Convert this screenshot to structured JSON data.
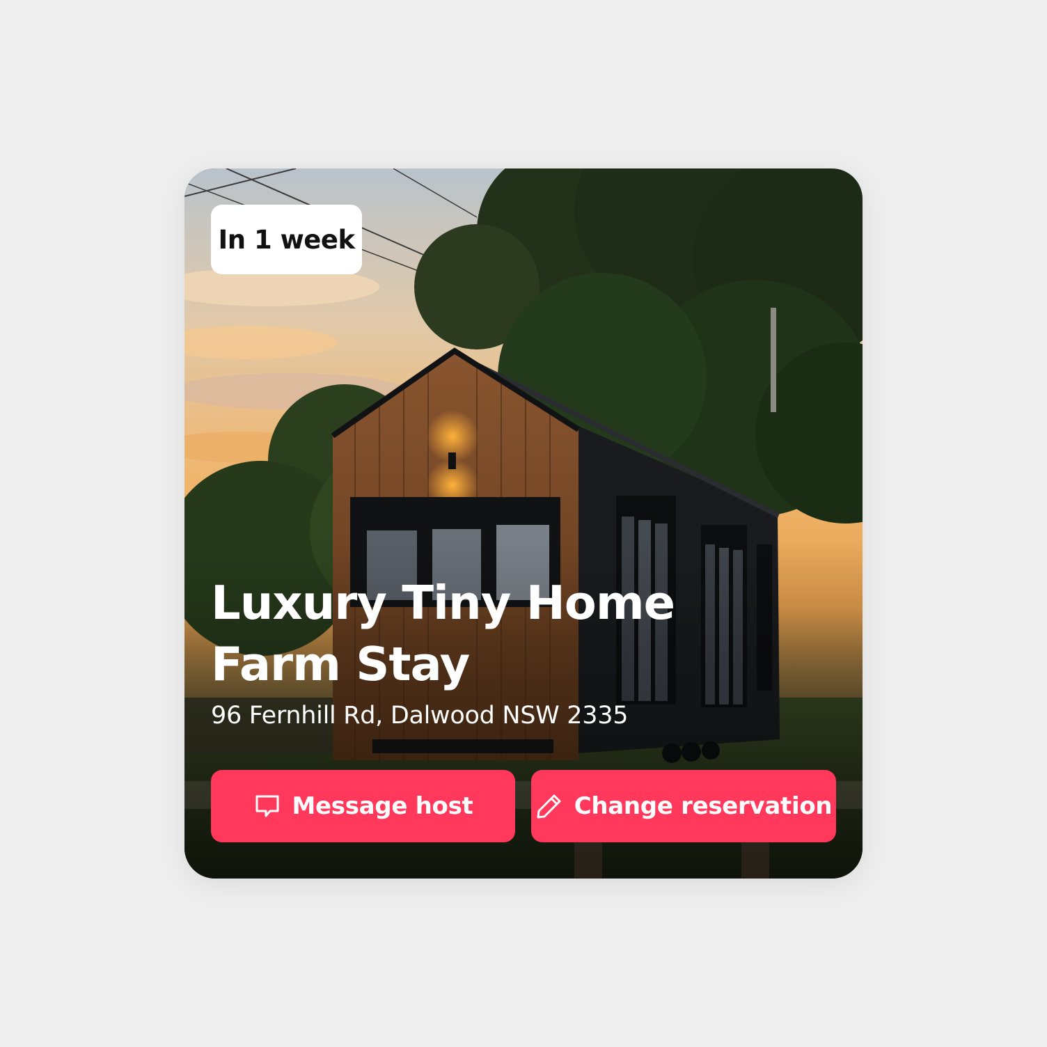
{
  "card": {
    "badge": "In 1 week",
    "title": "Luxury Tiny Home Farm Stay",
    "address": "96 Fernhill Rd, Dalwood NSW 2335",
    "photo_subject": "tiny home at sunset"
  },
  "actions": {
    "message_label": "Message host",
    "message_icon": "chat-bubble-icon",
    "change_label": "Change reservation",
    "change_icon": "pencil-icon"
  },
  "colors": {
    "accent": "#ff385c",
    "badge_bg": "#ffffff",
    "text_on_photo": "#ffffff",
    "page_bg": "#eeeeee"
  }
}
